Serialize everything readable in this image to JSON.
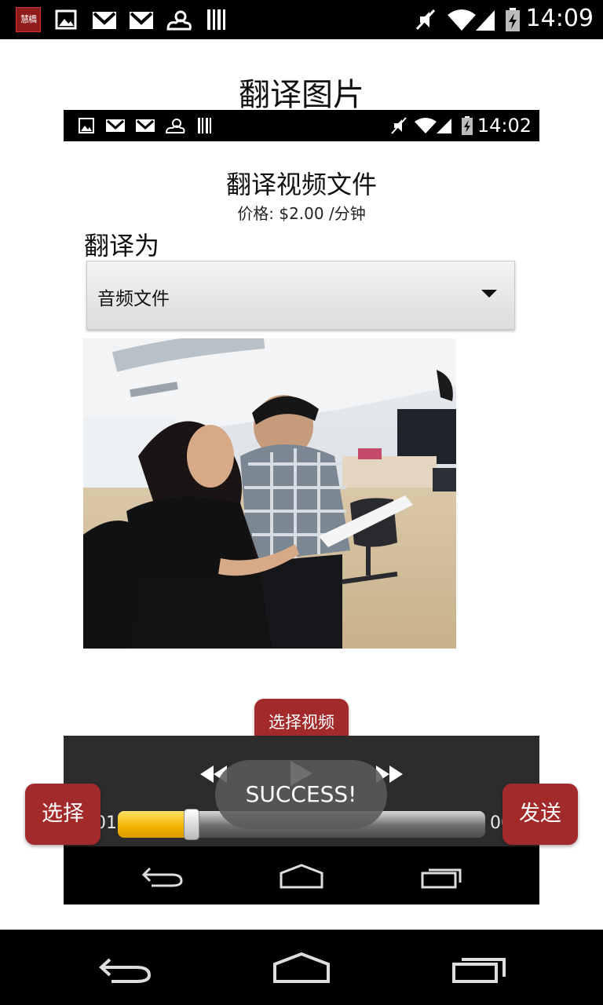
{
  "status_bar": {
    "time": "14:09",
    "app_icon_text": "慧橋",
    "icons": [
      "app-icon",
      "image-icon",
      "gmail-icon",
      "gmail-icon",
      "weather-icon",
      "barcode-icon",
      "mute-icon",
      "wifi-icon",
      "signal-icon",
      "battery-charging-icon"
    ]
  },
  "page": {
    "title": "翻译图片"
  },
  "screenshot": {
    "status_bar": {
      "time": "14:02"
    },
    "title": "翻译视频文件",
    "price": "价格: $2.00 /分钟",
    "translate_to_label": "翻译为",
    "dropdown": {
      "selected": "音频文件"
    },
    "pick_video_button": "选择视频",
    "player": {
      "time_left": "01",
      "time_right": "00",
      "progress_fraction": 0.2
    }
  },
  "toast": "SUCCESS!",
  "buttons": {
    "select": "选择",
    "send": "发送"
  },
  "nav": {
    "back": "back-icon",
    "home": "home-icon",
    "recents": "recents-icon"
  },
  "colors": {
    "accent_red": "#a32a2a",
    "seek_yellow": "#f2b400"
  }
}
